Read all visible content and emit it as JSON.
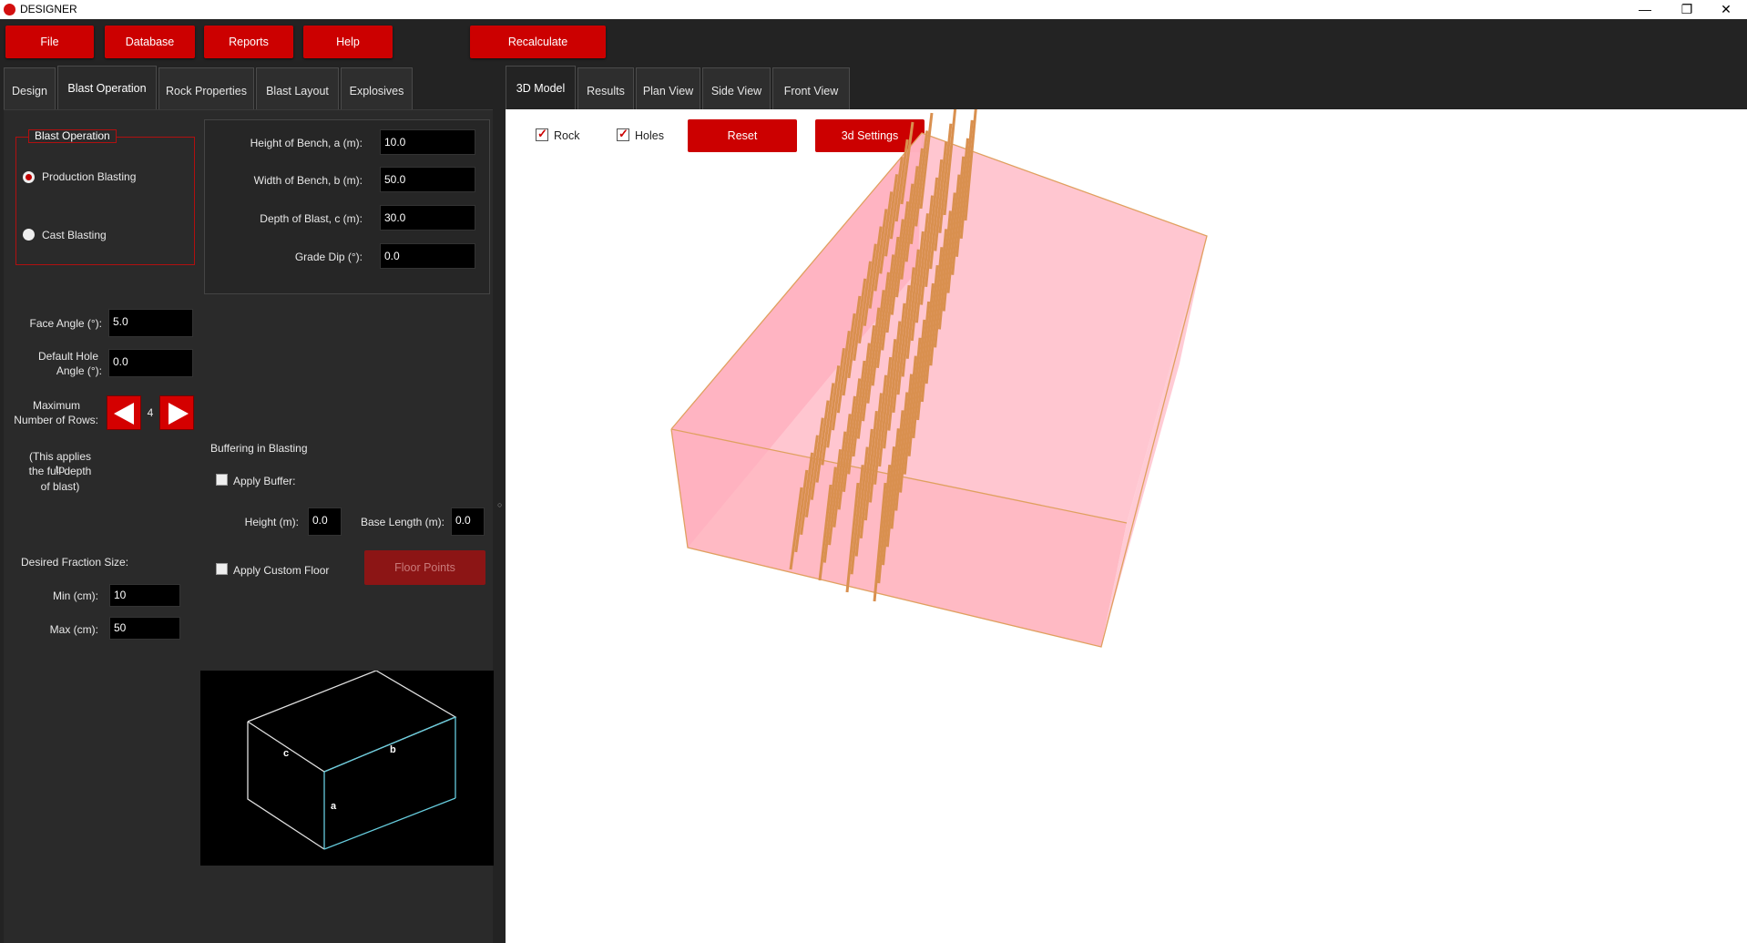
{
  "window": {
    "title": "DESIGNER",
    "minimize": "—",
    "restore": "❐",
    "close": "✕"
  },
  "menu": {
    "file": "File",
    "database": "Database",
    "reports": "Reports",
    "help": "Help",
    "recalculate": "Recalculate"
  },
  "left_tabs": [
    {
      "label": "Design"
    },
    {
      "label": "Blast Operation"
    },
    {
      "label": "Rock Properties"
    },
    {
      "label": "Blast Layout"
    },
    {
      "label": "Explosives"
    }
  ],
  "blast_operation": {
    "group_title": "Blast Operation",
    "production": "Production Blasting",
    "cast": "Cast Blasting",
    "selected": "production"
  },
  "bench": {
    "height_label": "Height of Bench, a (m):",
    "height_value": "10.0",
    "width_label": "Width of Bench, b (m):",
    "width_value": "50.0",
    "depth_label": "Depth of Blast, c (m):",
    "depth_value": "30.0",
    "dip_label": "Grade Dip (°):",
    "dip_value": "0.0"
  },
  "angles": {
    "face_label": "Face Angle (°):",
    "face_value": "5.0",
    "hole_label_1": "Default Hole",
    "hole_label_2": "Angle (°):",
    "hole_value": "0.0"
  },
  "rows": {
    "label_1": "Maximum",
    "label_2": "Number of Rows:",
    "value": "4",
    "note_1": "(This applies to",
    "note_2": "the full depth",
    "note_3": "of blast)"
  },
  "buffer": {
    "title": "Buffering in Blasting",
    "apply_buffer": "Apply Buffer:",
    "height_label": "Height (m):",
    "height_value": "0.0",
    "base_label": "Base Length (m):",
    "base_value": "0.0",
    "custom_floor": "Apply Custom Floor",
    "floor_points": "Floor Points"
  },
  "fraction": {
    "title": "Desired Fraction Size:",
    "min_label": "Min (cm):",
    "min_value": "10",
    "max_label": "Max (cm):",
    "max_value": "50"
  },
  "diagram": {
    "label_a": "a",
    "label_b": "b",
    "label_c": "c"
  },
  "right_tabs": [
    {
      "label": "3D Model"
    },
    {
      "label": "Results"
    },
    {
      "label": "Plan View"
    },
    {
      "label": "Side View"
    },
    {
      "label": "Front View"
    }
  ],
  "viewport": {
    "rock": "Rock",
    "holes": "Holes",
    "rock_checked": true,
    "holes_checked": true,
    "reset": "Reset",
    "settings": "3d Settings"
  },
  "colors": {
    "accent": "#cc0000",
    "rock_fill": "#ffc0cb",
    "hole_color": "#d9904f"
  }
}
